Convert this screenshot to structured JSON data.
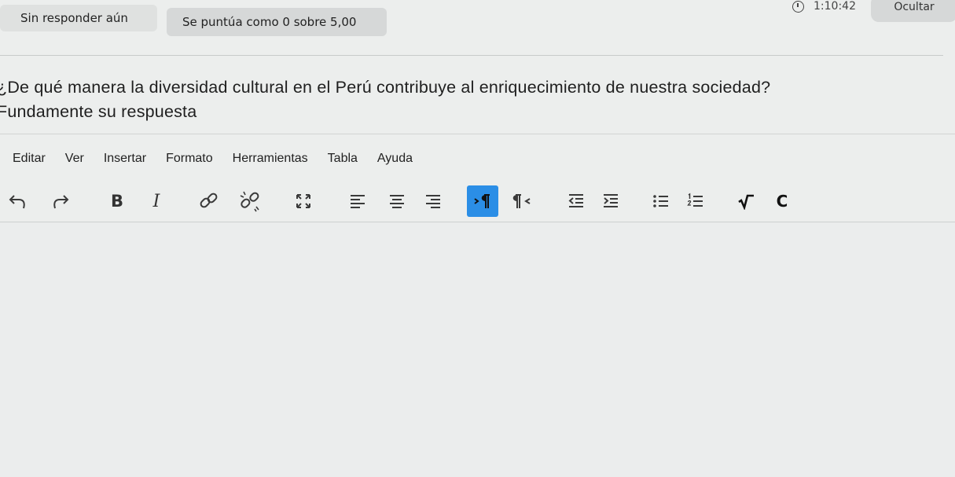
{
  "header": {
    "status": "Sin responder aún",
    "grade": "Se puntúa como 0 sobre 5,00",
    "timer": "1:10:42",
    "hide_label": "Ocultar"
  },
  "question": {
    "line1": "¿De qué manera la diversidad cultural en el Perú contribuye al enriquecimiento de nuestra sociedad?",
    "line2": "Fundamente su respuesta"
  },
  "editor": {
    "menu": [
      "Editar",
      "Ver",
      "Insertar",
      "Formato",
      "Herramientas",
      "Tabla",
      "Ayuda"
    ],
    "toolbar_icons": [
      "undo-icon",
      "redo-icon",
      "bold-icon",
      "italic-icon",
      "link-icon",
      "unlink-icon",
      "fullscreen-icon",
      "align-left-icon",
      "align-center-icon",
      "align-right-icon",
      "ltr-icon",
      "rtl-icon",
      "outdent-icon",
      "indent-icon",
      "bullet-list-icon",
      "numbered-list-icon",
      "equation-icon",
      "chemistry-icon"
    ],
    "bold_glyph": "B",
    "italic_glyph": "I",
    "chem_glyph": "C",
    "active_button_color": "#2b8ee6"
  }
}
